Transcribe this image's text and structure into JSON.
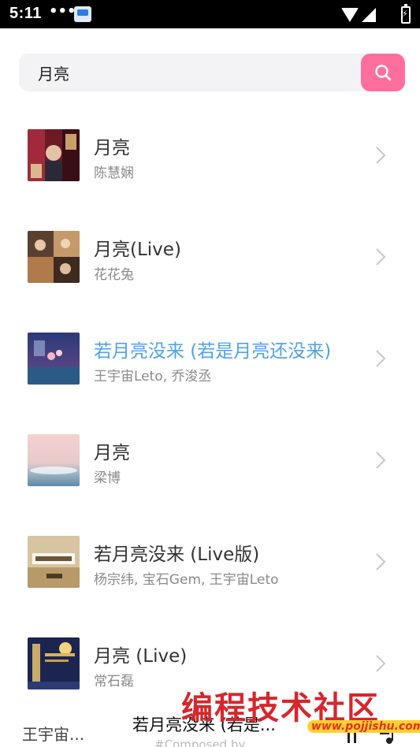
{
  "status_bar": {
    "time": "5:11",
    "dots": "•••"
  },
  "search": {
    "value": "月亮",
    "placeholder": ""
  },
  "songs": [
    {
      "title": "月亮",
      "artist": "陈慧娴",
      "active": false
    },
    {
      "title": "月亮(Live)",
      "artist": "花花兔",
      "active": false
    },
    {
      "title": "若月亮没来 (若是月亮还没来)",
      "artist": "王宇宙Leto, 乔浚丞",
      "active": true
    },
    {
      "title": "月亮",
      "artist": "梁博",
      "active": false
    },
    {
      "title": "若月亮没来 (Live版)",
      "artist": "杨宗纬, 宝石Gem, 王宇宙Leto",
      "active": false
    },
    {
      "title": "月亮 (Live)",
      "artist": "常石磊",
      "active": false
    }
  ],
  "player": {
    "artist": "王宇宙...",
    "title": "若月亮没来 (若是...",
    "subtitle": "#Composed by"
  },
  "watermark": {
    "text": "编程技术社区",
    "url": "www.pojjishu.com"
  },
  "colors": {
    "accent_pink": "#ff6f9e",
    "active_blue": "#4da3ea"
  }
}
